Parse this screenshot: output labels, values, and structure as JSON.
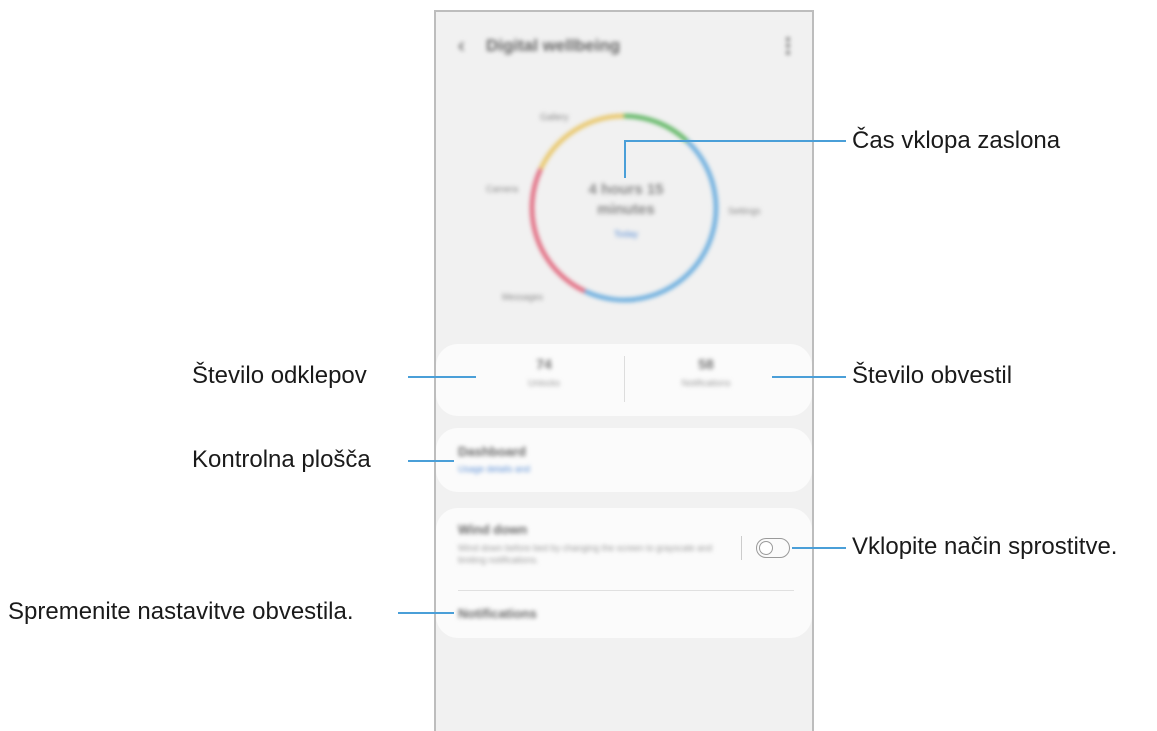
{
  "app": {
    "title": "Digital wellbeing",
    "back_icon": "chevron-left-icon",
    "more_icon": "more-vertical-icon"
  },
  "usage": {
    "total_line1": "4 hours 15",
    "total_line2": "minutes",
    "subtitle": "Today",
    "categories": [
      "Gallery",
      "Camera",
      "Settings",
      "Messages"
    ],
    "segments": [
      {
        "color": "#4caf50",
        "fraction": 0.12
      },
      {
        "color": "#5aa5dc",
        "fraction": 0.45
      },
      {
        "color": "#e05a72",
        "fraction": 0.25
      },
      {
        "color": "#e8c25a",
        "fraction": 0.18
      }
    ]
  },
  "stats": {
    "unlocks_value": "74",
    "unlocks_label": "Unlocks",
    "notifications_value": "58",
    "notifications_label": "Notifications"
  },
  "dashboard": {
    "title": "Dashboard",
    "link": "Usage details and"
  },
  "wind_down": {
    "title": "Wind down",
    "description": "Wind down before bed by changing the screen to grayscale and limiting notifications.",
    "notifications_label": "Notifications",
    "toggle_on": false
  },
  "callouts": {
    "screen_time": "Čas vklopa zaslona",
    "unlocks": "Število odklepov",
    "notifications": "Število obvestil",
    "dashboard": "Kontrolna plošča",
    "wind_down": "Vklopite način sprostitve.",
    "change_notifications": "Spremenite nastavitve obvestila."
  }
}
